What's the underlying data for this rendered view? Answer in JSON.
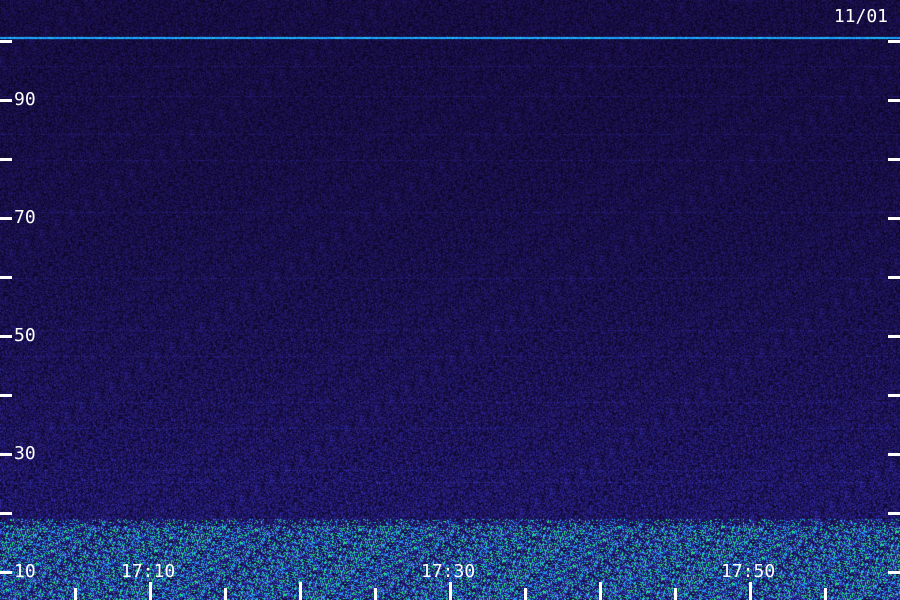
{
  "date_label": "11/01",
  "y_tick_labels": [
    "90",
    "70",
    "50",
    "30",
    "10"
  ],
  "x_tick_labels": [
    "17:10",
    "17:30",
    "17:50"
  ],
  "colors": {
    "background": "#0a0530",
    "noise_low": "#1a0a6a",
    "noise_mid": "#3b2fd0",
    "signal_cyan": "#22d0ff",
    "signal_green": "#40ff80",
    "axis": "#ffffff"
  }
}
